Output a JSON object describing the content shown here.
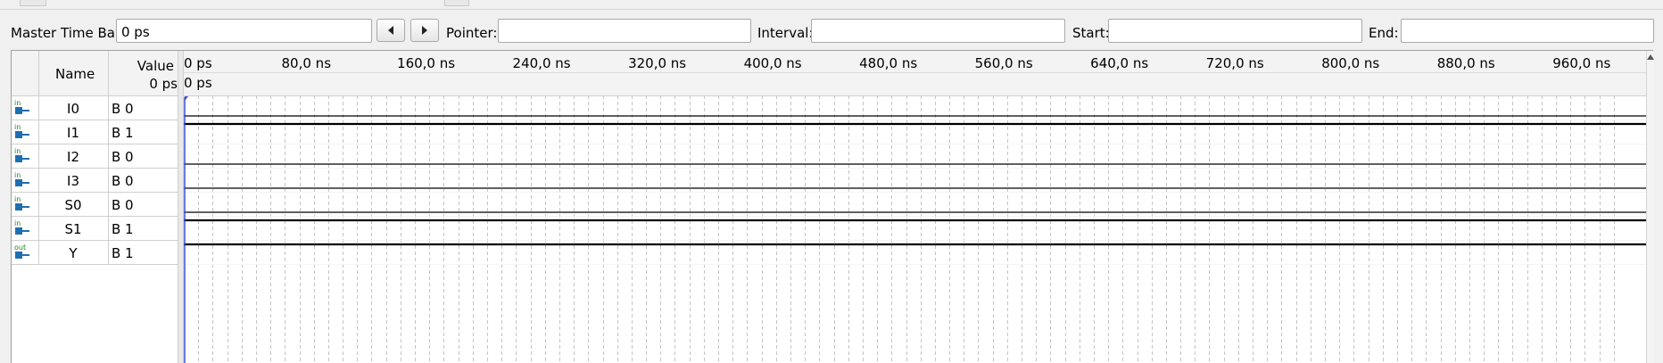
{
  "toolbar": {
    "master_time_bar_label": "Master Time Bar:",
    "master_time_bar_value": "0 ps",
    "prev_icon": "triangle-left-icon",
    "next_icon": "triangle-right-icon",
    "pointer_label": "Pointer:",
    "pointer_value": "",
    "interval_label": "Interval:",
    "interval_value": "",
    "start_label": "Start:",
    "start_value": "",
    "end_label": "End:",
    "end_value": ""
  },
  "table": {
    "name_header": "Name",
    "value_header": "Value",
    "value_subheader": "0 ps",
    "rows": [
      {
        "pin": "in",
        "name": "I0",
        "value": "B 0"
      },
      {
        "pin": "in",
        "name": "I1",
        "value": "B 1"
      },
      {
        "pin": "in",
        "name": "I2",
        "value": "B 0"
      },
      {
        "pin": "in",
        "name": "I3",
        "value": "B 0"
      },
      {
        "pin": "in",
        "name": "S0",
        "value": "B 0"
      },
      {
        "pin": "in",
        "name": "S1",
        "value": "B 1"
      },
      {
        "pin": "out",
        "name": "Y",
        "value": "B 1"
      }
    ]
  },
  "timeline": {
    "ticks": [
      "0 ps",
      "80,0 ns",
      "160,0 ns",
      "240,0 ns",
      "320,0 ns",
      "400,0 ns",
      "480,0 ns",
      "560,0 ns",
      "640,0 ns",
      "720,0 ns",
      "800,0 ns",
      "880,0 ns",
      "960,0 ns"
    ],
    "tick_values_ns": [
      0,
      80,
      160,
      240,
      320,
      400,
      480,
      560,
      640,
      720,
      800,
      880,
      960
    ],
    "cursor_label": "0 ps",
    "range_ns": [
      0,
      1000
    ],
    "waveform_levels": [
      0,
      1,
      0,
      0,
      0,
      1,
      1
    ],
    "cursor_color": "#3a4fd8",
    "wave_color": "#000000",
    "pin_color": "#1f6fb0",
    "pin_text_color": "#1a8a1a"
  }
}
